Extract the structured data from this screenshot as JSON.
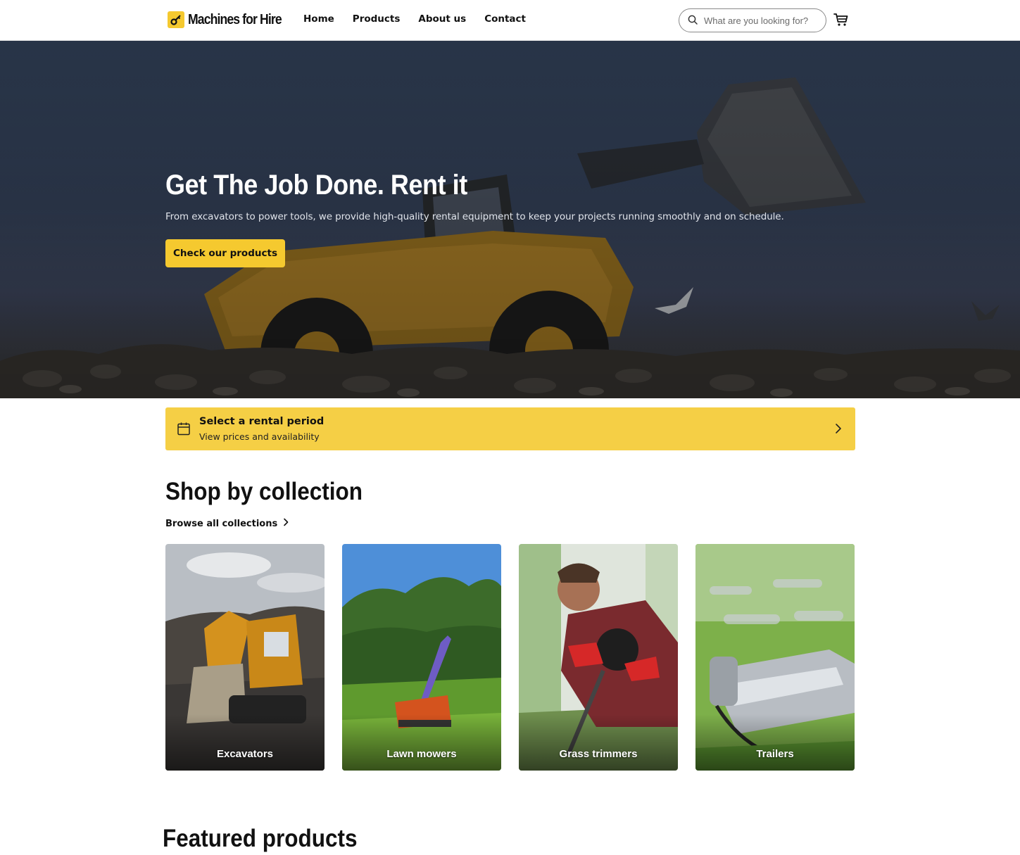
{
  "header": {
    "logo_text": "Machines for Hire",
    "nav": [
      "Home",
      "Products",
      "About us",
      "Contact"
    ],
    "search_placeholder": "What are you looking for?"
  },
  "hero": {
    "title": "Get The Job Done. Rent it",
    "subtitle": "From excavators to power tools, we provide high-quality rental equipment to keep your projects running smoothly and on schedule.",
    "cta": "Check our products"
  },
  "rental": {
    "title": "Select a rental period",
    "subtitle": "View prices and availability"
  },
  "collections": {
    "title": "Shop by collection",
    "browse": "Browse all collections",
    "items": [
      "Excavators",
      "Lawn mowers",
      "Grass trimmers",
      "Trailers"
    ]
  },
  "featured": {
    "title": "Featured products"
  },
  "colors": {
    "accent": "#f5c92f",
    "rental_bar": "#f5cf45",
    "hero_sky": "#2f3d54"
  },
  "icons": [
    "logo-key-icon",
    "search-icon",
    "cart-icon",
    "calendar-icon",
    "chevron-right-icon"
  ]
}
